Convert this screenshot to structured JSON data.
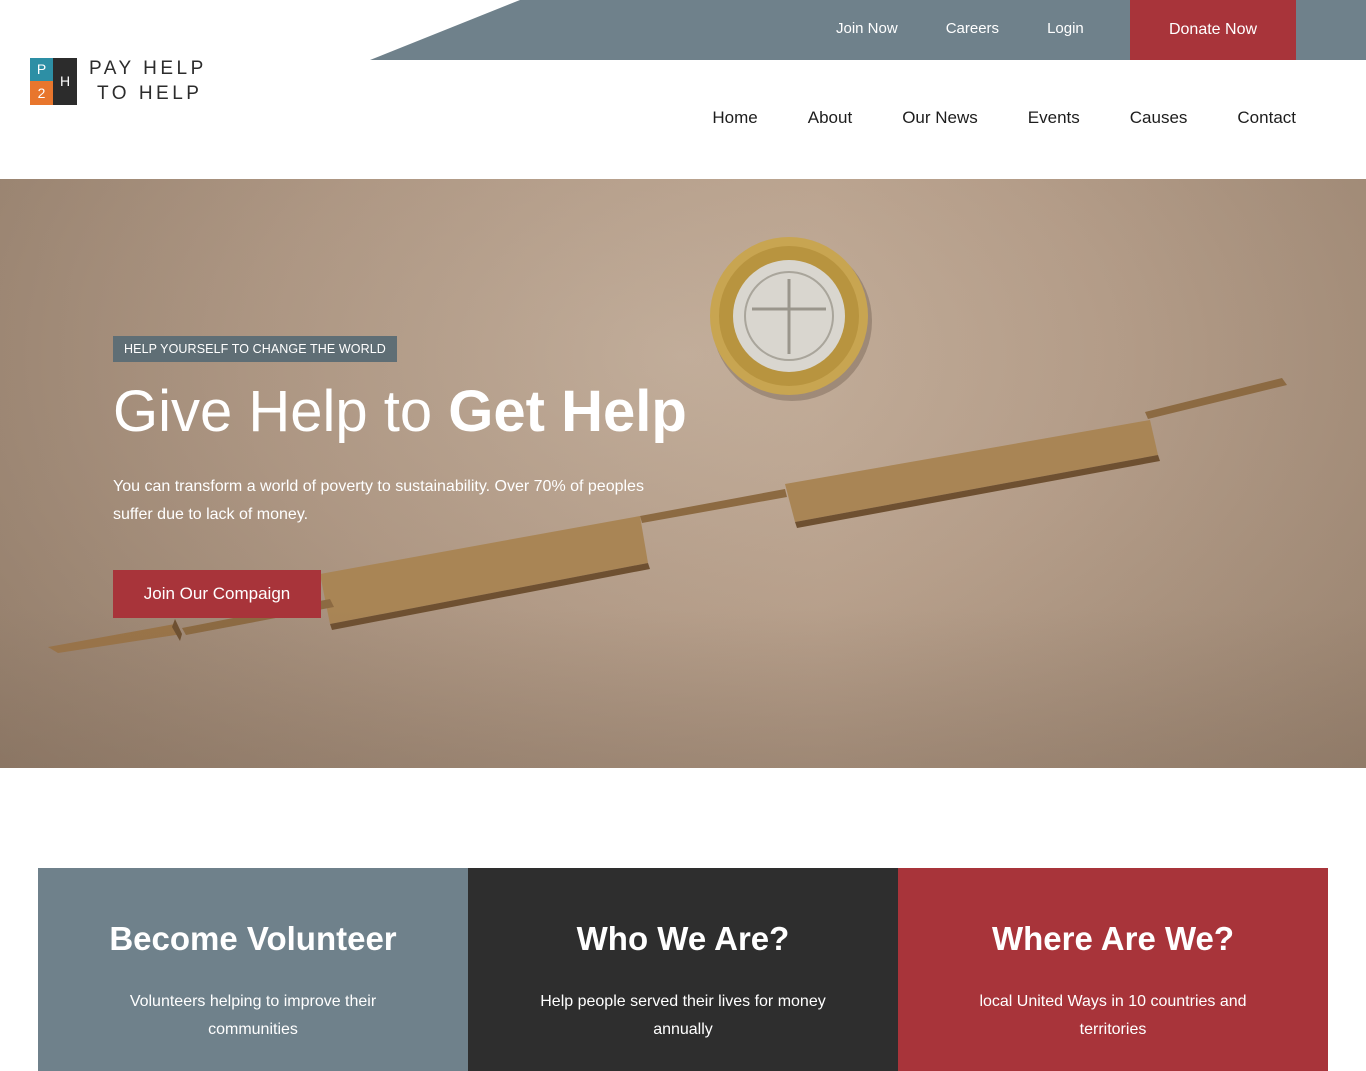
{
  "brand": {
    "logo_letters": {
      "p": "P",
      "h": "H",
      "two": "2"
    },
    "name_line1": "PAY HELP",
    "name_line2": "TO HELP",
    "colors": {
      "slate": "#6f818b",
      "red": "#a8343a",
      "dark": "#2e2e2e",
      "teal": "#2d8fa5",
      "orange": "#e8762d"
    }
  },
  "topbar": {
    "links": [
      "Join Now",
      "Careers",
      "Login"
    ],
    "donate_label": "Donate Now"
  },
  "nav": {
    "items": [
      "Home",
      "About",
      "Our News",
      "Events",
      "Causes",
      "Contact"
    ]
  },
  "hero": {
    "tag": "HELP YOURSELF TO CHANGE THE WORLD",
    "title_light": "Give Help to ",
    "title_bold": "Get Help",
    "description": "You can transform a world of poverty to sustainability. Over 70% of peoples suffer due to lack of money.",
    "cta_label": "Join Our Compaign"
  },
  "features": [
    {
      "title": "Become Volunteer",
      "text": "Volunteers helping to improve their communities"
    },
    {
      "title": "Who We Are?",
      "text": "Help people served their lives for money annually"
    },
    {
      "title": "Where Are We?",
      "text": "local United Ways in 10 countries and territories"
    }
  ]
}
